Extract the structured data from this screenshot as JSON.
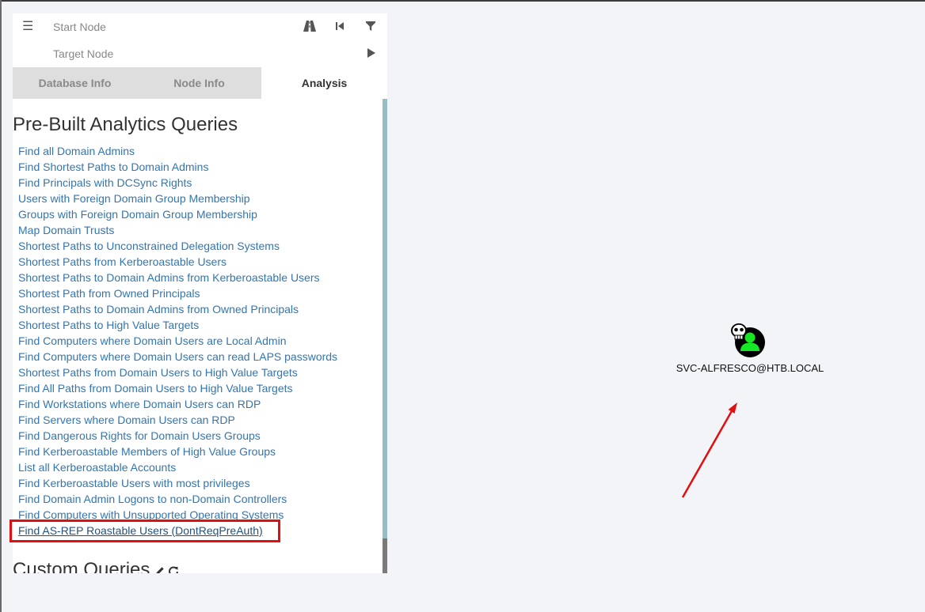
{
  "search": {
    "start_placeholder": "Start Node",
    "target_placeholder": "Target Node"
  },
  "tabs": [
    {
      "label": "Database Info",
      "active": false
    },
    {
      "label": "Node Info",
      "active": false
    },
    {
      "label": "Analysis",
      "active": true
    }
  ],
  "analysis": {
    "prebuilt_heading": "Pre-Built Analytics Queries",
    "queries": [
      "Find all Domain Admins",
      "Find Shortest Paths to Domain Admins",
      "Find Principals with DCSync Rights",
      "Users with Foreign Domain Group Membership",
      "Groups with Foreign Domain Group Membership",
      "Map Domain Trusts",
      "Shortest Paths to Unconstrained Delegation Systems",
      "Shortest Paths from Kerberoastable Users",
      "Shortest Paths to Domain Admins from Kerberoastable Users",
      "Shortest Path from Owned Principals",
      "Shortest Paths to Domain Admins from Owned Principals",
      "Shortest Paths to High Value Targets",
      "Find Computers where Domain Users are Local Admin",
      "Find Computers where Domain Users can read LAPS passwords",
      "Shortest Paths from Domain Users to High Value Targets",
      "Find All Paths from Domain Users to High Value Targets",
      "Find Workstations where Domain Users can RDP",
      "Find Servers where Domain Users can RDP",
      "Find Dangerous Rights for Domain Users Groups",
      "Find Kerberoastable Members of High Value Groups",
      "List all Kerberoastable Accounts",
      "Find Kerberoastable Users with most privileges",
      "Find Domain Admin Logons to non-Domain Controllers",
      "Find Computers with Unsupported Operating Systems",
      "Find AS-REP Roastable Users (DontReqPreAuth)"
    ],
    "highlighted_query_index": 24,
    "custom_heading": "Custom Queries"
  },
  "graph": {
    "node_label": "SVC-ALFRESCO@HTB.LOCAL",
    "node_type": "user",
    "node_owned_marker": "skull-icon",
    "node_color": "#17e625"
  },
  "icons": {
    "menu": "hamburger-icon",
    "pathfinding": "road-icon",
    "back": "step-backward-icon",
    "filter": "filter-icon",
    "play": "play-icon",
    "edit": "pencil-icon",
    "refresh": "refresh-icon"
  },
  "colors": {
    "link": "#3276b1",
    "annotation": "#e01010",
    "scrollbar_track": "#95bec5",
    "tab_inactive_bg": "#dedede",
    "canvas_bg": "#f2f4f8"
  }
}
